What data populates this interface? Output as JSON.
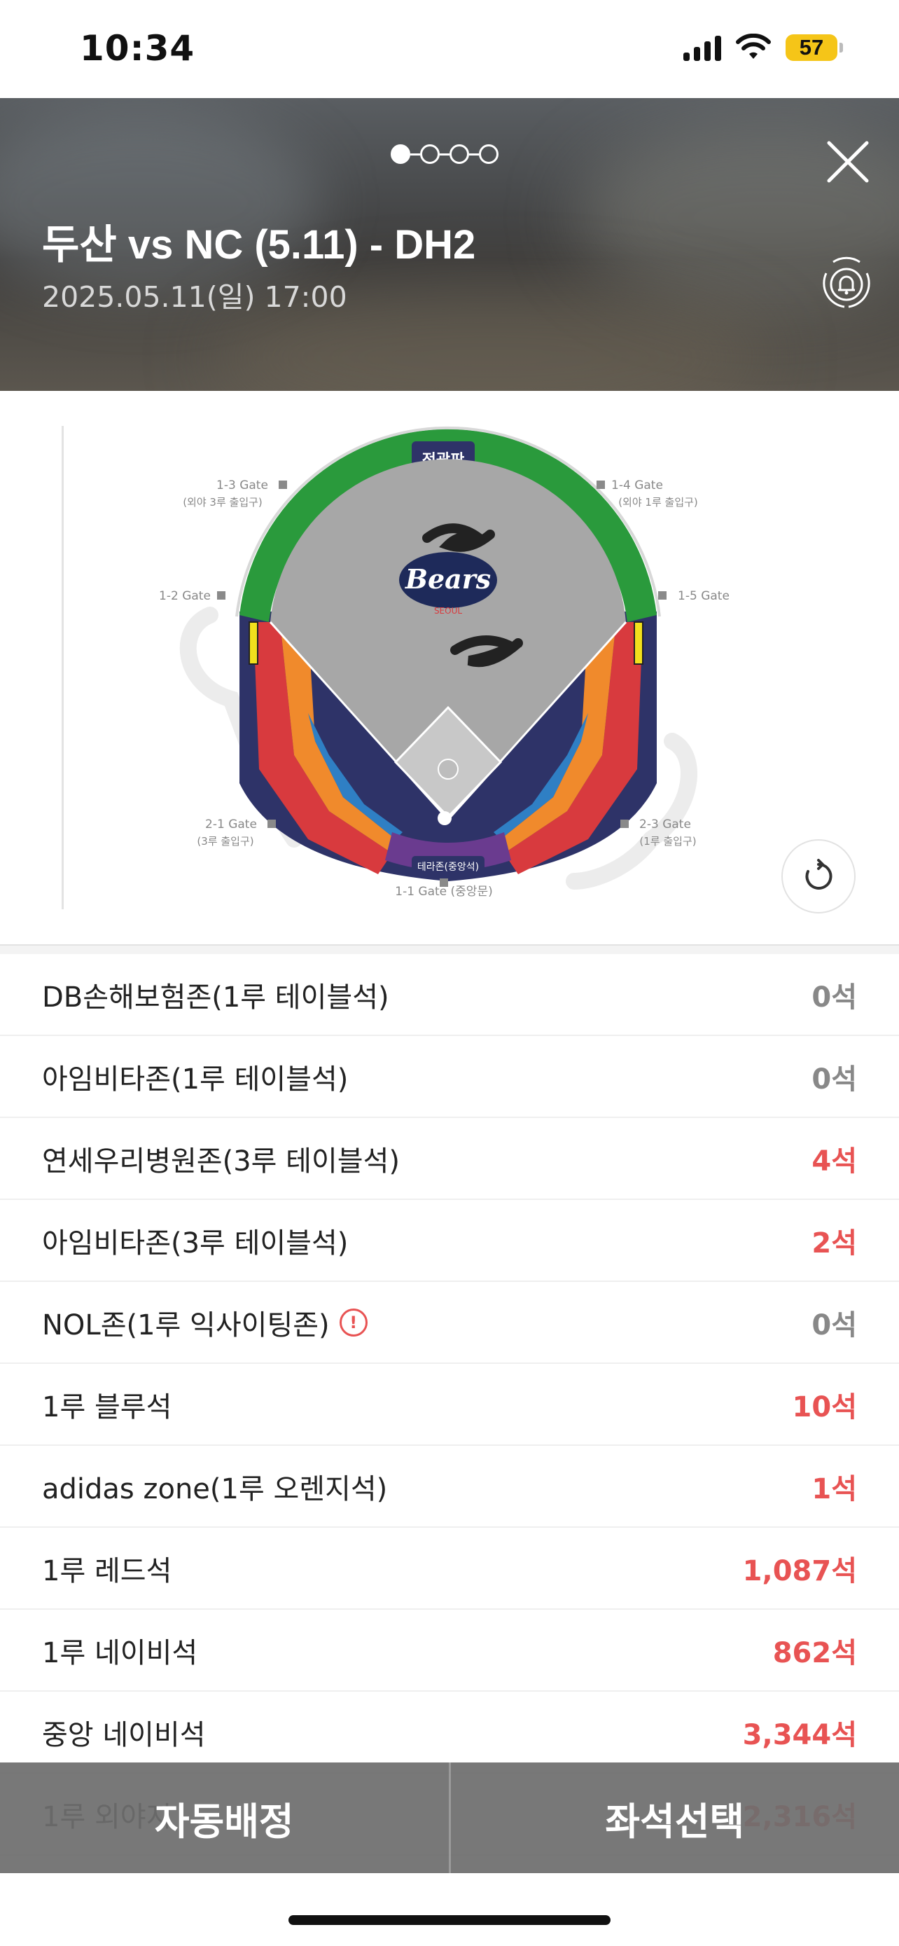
{
  "status_bar": {
    "time": "10:34",
    "battery": "57"
  },
  "header": {
    "title": "두산 vs NC (5.11) - DH2",
    "datetime": "2025.05.11(일) 17:00",
    "page_indicator": {
      "count": 4,
      "active": 1
    }
  },
  "stadium": {
    "scoreboard": "전광판",
    "central_zone": "테라존(중앙석)",
    "gates": {
      "g13": "1-3 Gate",
      "g13_sub": "(외야 3루 출입구)",
      "g14": "1-4 Gate",
      "g14_sub": "(외야 1루 출입구)",
      "g12": "1-2 Gate",
      "g15": "1-5 Gate",
      "g21": "2-1 Gate",
      "g21_sub": "(3루 출입구)",
      "g23": "2-3 Gate",
      "g23_sub": "(1루 출입구)",
      "g11": "1-1 Gate (중앙문)"
    },
    "logo_text": "Bears",
    "logo_sub": "SEOUL"
  },
  "seats": [
    {
      "name": "DB손해보험존(1루 테이블석)",
      "count": "0석",
      "available": false,
      "info": false
    },
    {
      "name": "아임비타존(1루 테이블석)",
      "count": "0석",
      "available": false,
      "info": false
    },
    {
      "name": "연세우리병원존(3루 테이블석)",
      "count": "4석",
      "available": true,
      "info": false
    },
    {
      "name": "아임비타존(3루 테이블석)",
      "count": "2석",
      "available": true,
      "info": false
    },
    {
      "name": "NOL존(1루 익사이팅존)",
      "count": "0석",
      "available": false,
      "info": true
    },
    {
      "name": "1루 블루석",
      "count": "10석",
      "available": true,
      "info": false
    },
    {
      "name": "adidas zone(1루 오렌지석)",
      "count": "1석",
      "available": true,
      "info": false
    },
    {
      "name": "1루 레드석",
      "count": "1,087석",
      "available": true,
      "info": false
    },
    {
      "name": "1루 네이비석",
      "count": "862석",
      "available": true,
      "info": false
    },
    {
      "name": "중앙 네이비석",
      "count": "3,344석",
      "available": true,
      "info": false
    },
    {
      "name": "1루 외야지",
      "count": "2,316석",
      "available": true,
      "info": false
    }
  ],
  "actions": {
    "auto_assign": "자동배정",
    "select_seat": "좌석선택"
  },
  "colors": {
    "available": "#e85353",
    "unavailable": "#888888",
    "navy": "#2e3368",
    "red": "#d83a3e",
    "orange": "#f08a2c",
    "blue": "#2f7fc4",
    "green": "#2a9a3c",
    "purple": "#6a3b8f"
  }
}
